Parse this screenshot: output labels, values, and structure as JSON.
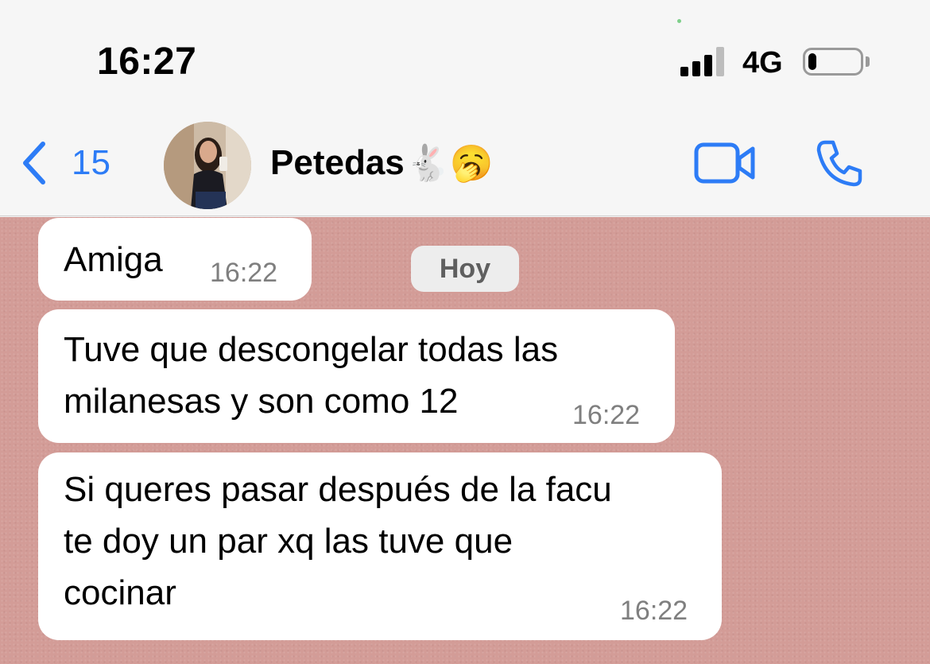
{
  "status_bar": {
    "time": "16:27",
    "network": "4G",
    "signal_bars_active": 3,
    "signal_bars_total": 4,
    "battery_level": 0.15
  },
  "header": {
    "back_count": "15",
    "contact_name": "Petedas",
    "contact_emoji": "🐇🥱",
    "icons": {
      "back": "chevron-left-icon",
      "video": "video-camera-icon",
      "call": "phone-icon"
    }
  },
  "chat": {
    "date_label": "Hoy",
    "messages": [
      {
        "text": "Amiga",
        "time": "16:22"
      },
      {
        "text": "Tuve que descongelar todas las\nmilanesas y son como 12",
        "time": "16:22"
      },
      {
        "text": "Si queres pasar después de la facu\nte doy un par xq las tuve que\ncocinar",
        "time": "16:22"
      }
    ]
  },
  "colors": {
    "accent": "#2d7cf6",
    "chat_background": "#d39c97",
    "bubble": "#ffffff",
    "header_background": "#f6f6f6"
  }
}
